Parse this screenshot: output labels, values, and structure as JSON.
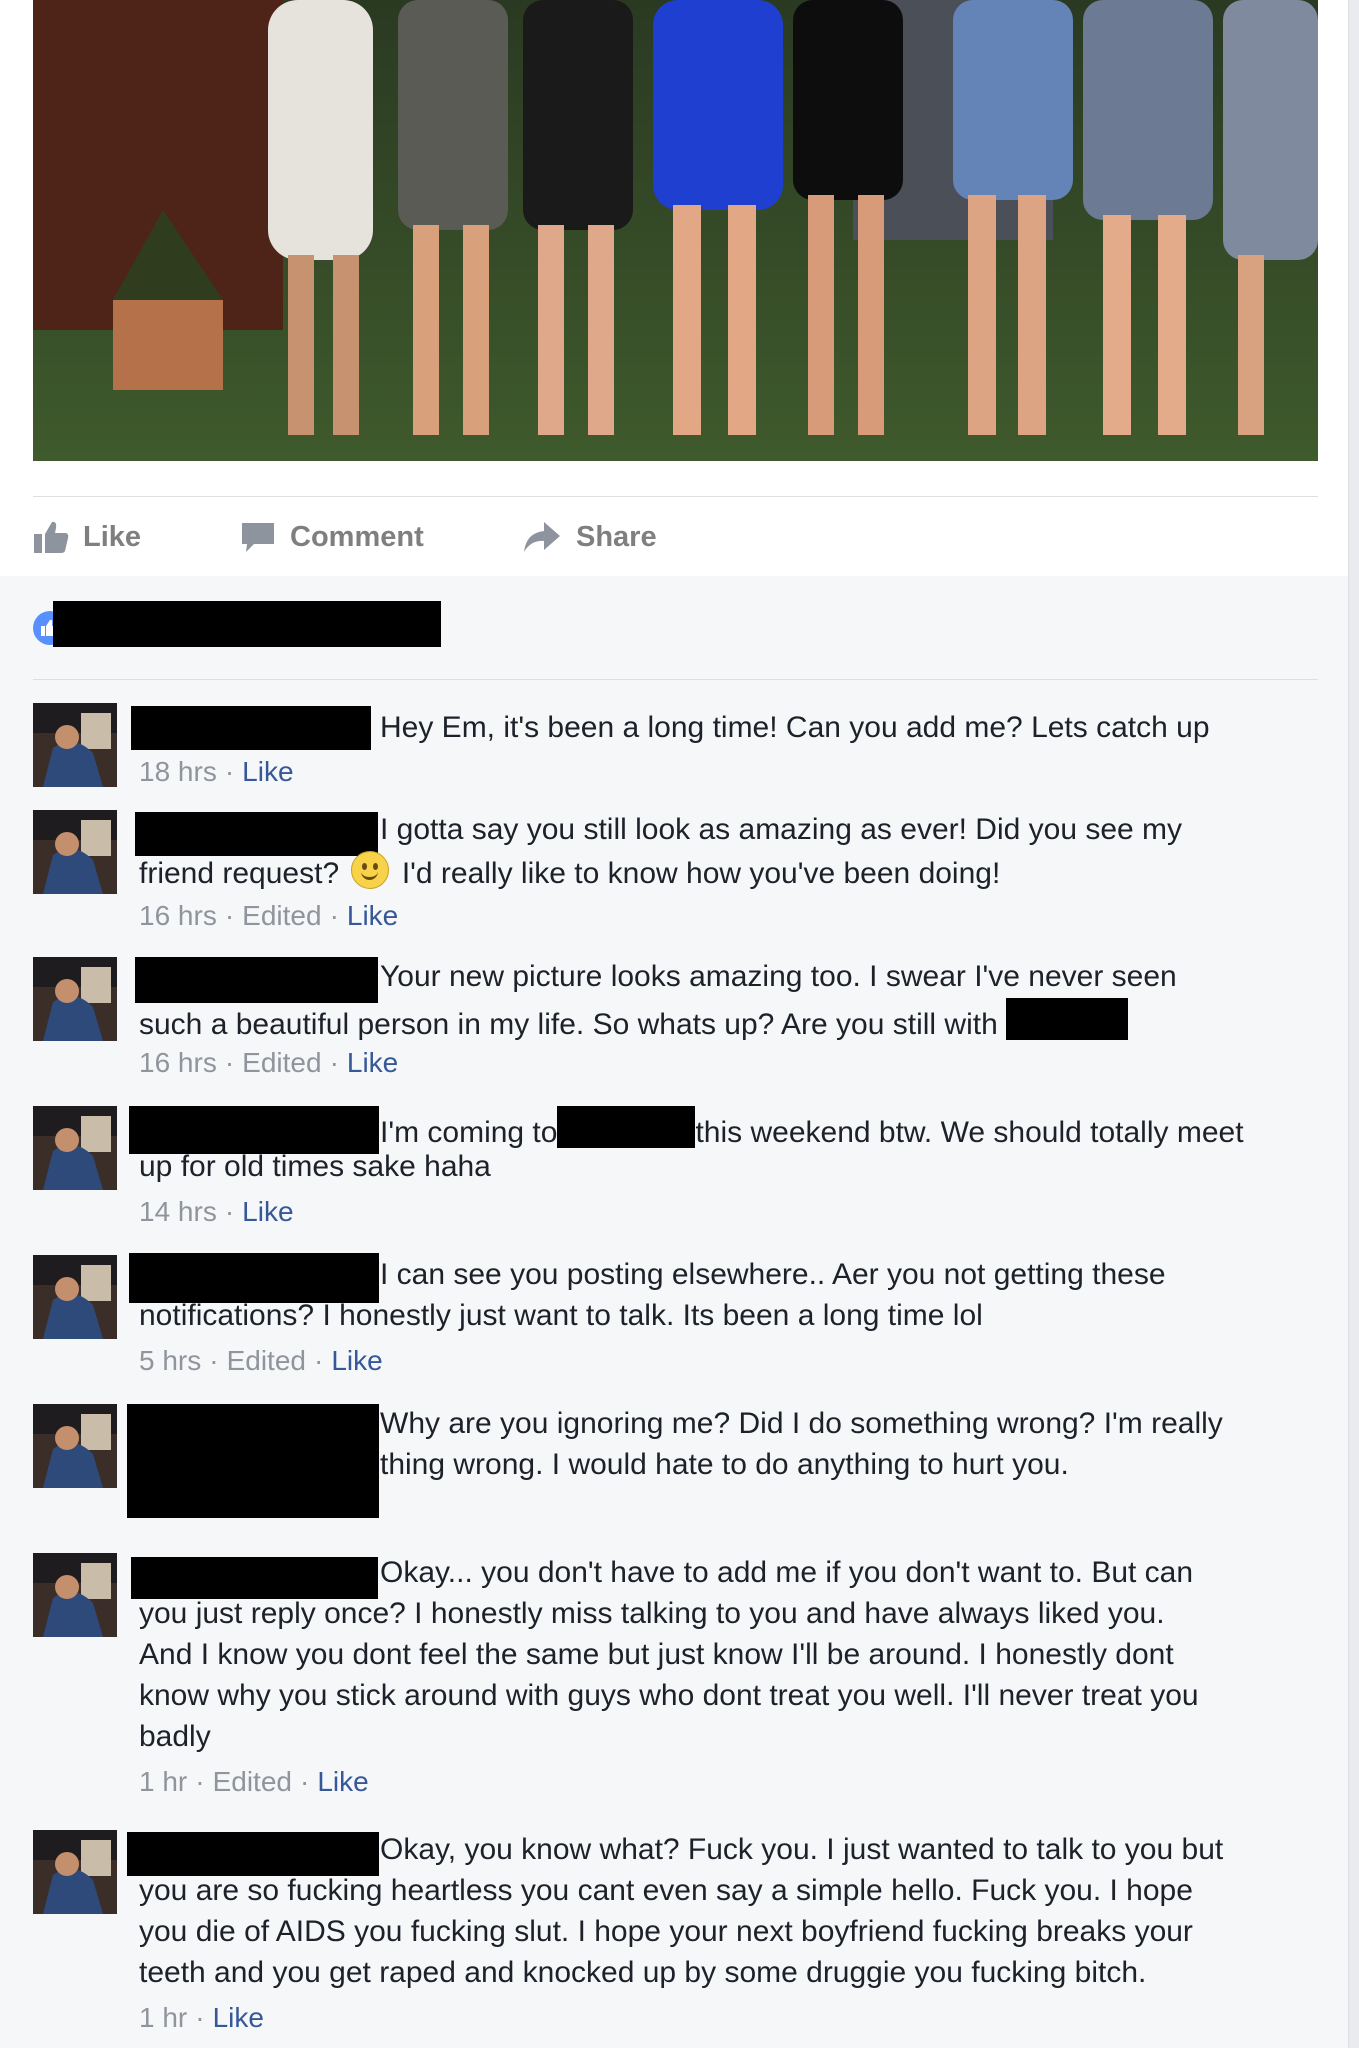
{
  "post": {
    "actions": {
      "like": "Like",
      "comment": "Comment",
      "share": "Share"
    }
  },
  "comments": [
    {
      "lines": [
        "Hey Em, it's been a long time! Can you add me? Lets catch up"
      ],
      "time": "18 hrs",
      "edited": "",
      "like": "Like"
    },
    {
      "lines": [
        "I gotta say you still look as amazing as ever! Did you see my",
        "friend request?",
        "I'd really like to know how you've been doing!"
      ],
      "time": "16 hrs",
      "edited": "Edited",
      "like": "Like"
    },
    {
      "lines": [
        "Your new picture looks amazing too. I swear I've never seen",
        "such a beautiful person in my life. So whats up? Are you still with"
      ],
      "time": "16 hrs",
      "edited": "Edited",
      "like": "Like"
    },
    {
      "lines": [
        "I'm coming to",
        "this weekend btw. We should totally meet",
        "up for old times sake haha"
      ],
      "time": "14 hrs",
      "edited": "",
      "like": "Like"
    },
    {
      "lines": [
        "I can see you posting elsewhere.. Aer you not getting these",
        "notifications? I honestly just want to talk. Its been a long time lol"
      ],
      "time": "5 hrs",
      "edited": "Edited",
      "like": "Like"
    },
    {
      "lines": [
        "Why are you ignoring me? Did I do something wrong? I'm really",
        "thing wrong. I would hate to do anything to hurt you."
      ],
      "time": "",
      "edited": "",
      "like": ""
    },
    {
      "lines": [
        "Okay... you don't have to add me if you don't want to. But can",
        "you just reply once? I honestly miss talking to you and have always liked you.",
        "And I know you dont feel the same but just know I'll be around. I honestly dont",
        "know why you stick around with guys who dont treat you well. I'll never treat you",
        "badly"
      ],
      "time": "1 hr",
      "edited": "Edited",
      "like": "Like"
    },
    {
      "lines": [
        "Okay, you know what? Fuck you. I just wanted to talk to you but",
        "you are so fucking heartless you cant even say a simple hello. Fuck you. I hope",
        "you die of AIDS you fucking slut. I hope your next boyfriend fucking breaks your",
        "teeth and you get raped and knocked up by some druggie you fucking bitch."
      ],
      "time": "1 hr",
      "edited": "",
      "like": "Like"
    }
  ],
  "colors": {
    "link": "#365899",
    "meta": "#90949c",
    "text": "#1d2129",
    "action": "#7f7f7f",
    "like_icon": "#5890ff"
  },
  "icons": {
    "like": "thumbs-up-icon",
    "comment": "speech-bubble-icon",
    "share": "share-arrow-icon",
    "reaction": "like-reaction-icon",
    "emoji": "smiley-emoji-icon"
  }
}
